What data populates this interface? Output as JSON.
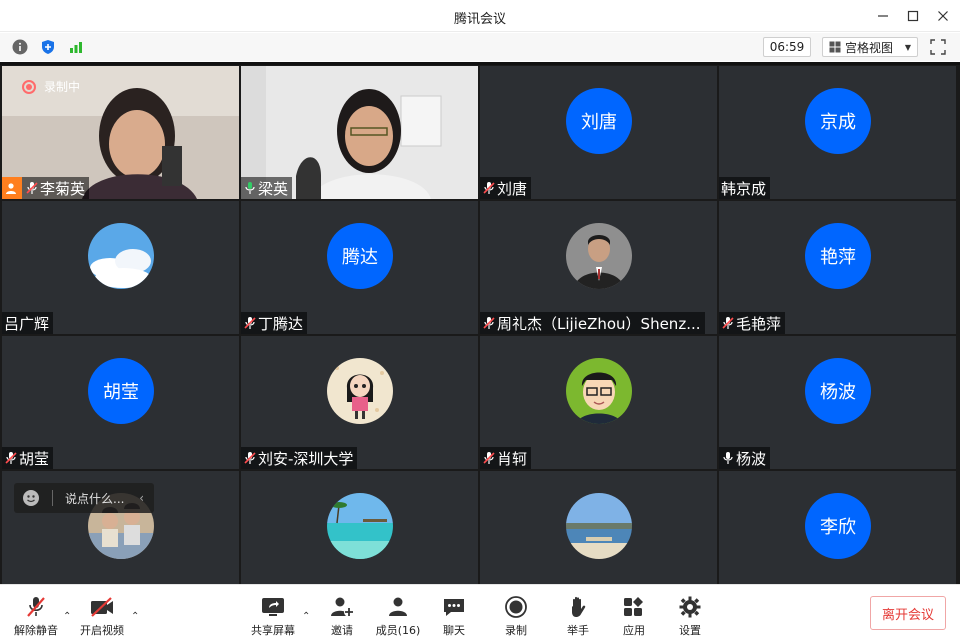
{
  "window": {
    "title": "腾讯会议"
  },
  "infobar": {
    "timer": "06:59",
    "view_mode": "宫格视图"
  },
  "recording_label": "录制中",
  "tiles": [
    {
      "name": "李菊英",
      "avatar": "",
      "mic": "muted",
      "type": "camera"
    },
    {
      "name": "梁英",
      "avatar": "",
      "mic": "active",
      "type": "camera"
    },
    {
      "name": "刘唐",
      "avatar": "刘唐",
      "mic": "muted",
      "type": "initials"
    },
    {
      "name": "韩京成",
      "avatar": "京成",
      "mic": "none",
      "type": "initials"
    },
    {
      "name": "吕广辉",
      "avatar": "",
      "mic": "none",
      "type": "photo-sky"
    },
    {
      "name": "丁腾达",
      "avatar": "腾达",
      "mic": "muted",
      "type": "initials"
    },
    {
      "name": "周礼杰（LijieZhou）Shenz...",
      "avatar": "",
      "mic": "muted",
      "type": "photo-man"
    },
    {
      "name": "毛艳萍",
      "avatar": "艳萍",
      "mic": "muted",
      "type": "initials"
    },
    {
      "name": "胡莹",
      "avatar": "胡莹",
      "mic": "muted",
      "type": "initials"
    },
    {
      "name": "刘安-深圳大学",
      "avatar": "",
      "mic": "muted",
      "type": "photo-girl"
    },
    {
      "name": "肖轲",
      "avatar": "",
      "mic": "muted",
      "type": "photo-cartoon"
    },
    {
      "name": "杨波",
      "avatar": "杨波",
      "mic": "on",
      "type": "initials"
    },
    {
      "name": "",
      "avatar": "",
      "mic": "none",
      "type": "photo-family"
    },
    {
      "name": "",
      "avatar": "",
      "mic": "none",
      "type": "photo-beach"
    },
    {
      "name": "",
      "avatar": "",
      "mic": "none",
      "type": "photo-coast"
    },
    {
      "name": "",
      "avatar": "李欣",
      "mic": "none",
      "type": "initials"
    }
  ],
  "chat": {
    "placeholder": "说点什么..."
  },
  "toolbar": {
    "unmute": "解除静音",
    "start_video": "开启视频",
    "share_screen": "共享屏幕",
    "invite": "邀请",
    "members": "成员(16)",
    "chat": "聊天",
    "record": "录制",
    "raise_hand": "举手",
    "apps": "应用",
    "settings": "设置",
    "leave": "离开会议"
  },
  "colors": {
    "avatar_blue": "#0066ff",
    "tile_bg": "#2c2f33",
    "leave_red": "#e53935",
    "active_green": "#33cc66",
    "host_orange": "#ff7f1f"
  }
}
